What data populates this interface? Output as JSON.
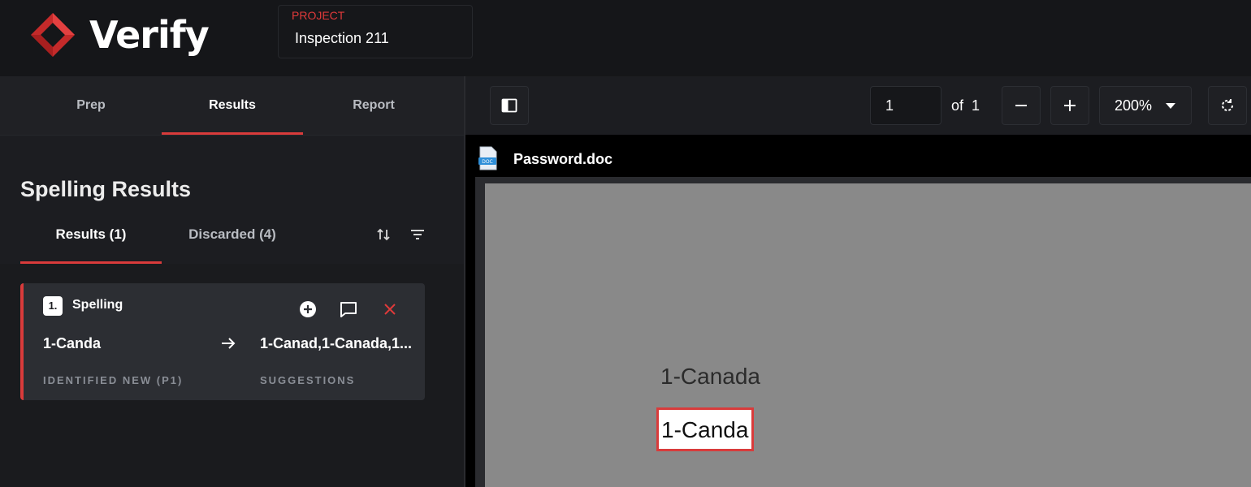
{
  "app": {
    "name": "Verify"
  },
  "project": {
    "label": "PROJECT",
    "name": "Inspection 211"
  },
  "main_tabs": [
    {
      "label": "Prep"
    },
    {
      "label": "Results"
    },
    {
      "label": "Report"
    }
  ],
  "panel": {
    "title": "Spelling Results",
    "subtabs": [
      {
        "label": "Results (1)"
      },
      {
        "label": "Discarded (4)"
      }
    ]
  },
  "result_card": {
    "index": "1.",
    "type": "Spelling",
    "identified": "1-Canda",
    "identified_caption": "IDENTIFIED NEW (P1)",
    "suggestions": "1-Canad,1-Canada,1...",
    "suggestions_caption": "SUGGESTIONS"
  },
  "viewer": {
    "page_current": "1",
    "page_of_label": "of",
    "page_total": "1",
    "zoom": "200%",
    "file_name": "Password.doc",
    "doc_line1": "1-Canada",
    "doc_line2": "1-Canda"
  },
  "colors": {
    "accent": "#d93b3b",
    "background": "#151619",
    "card": "#2c2e33"
  }
}
